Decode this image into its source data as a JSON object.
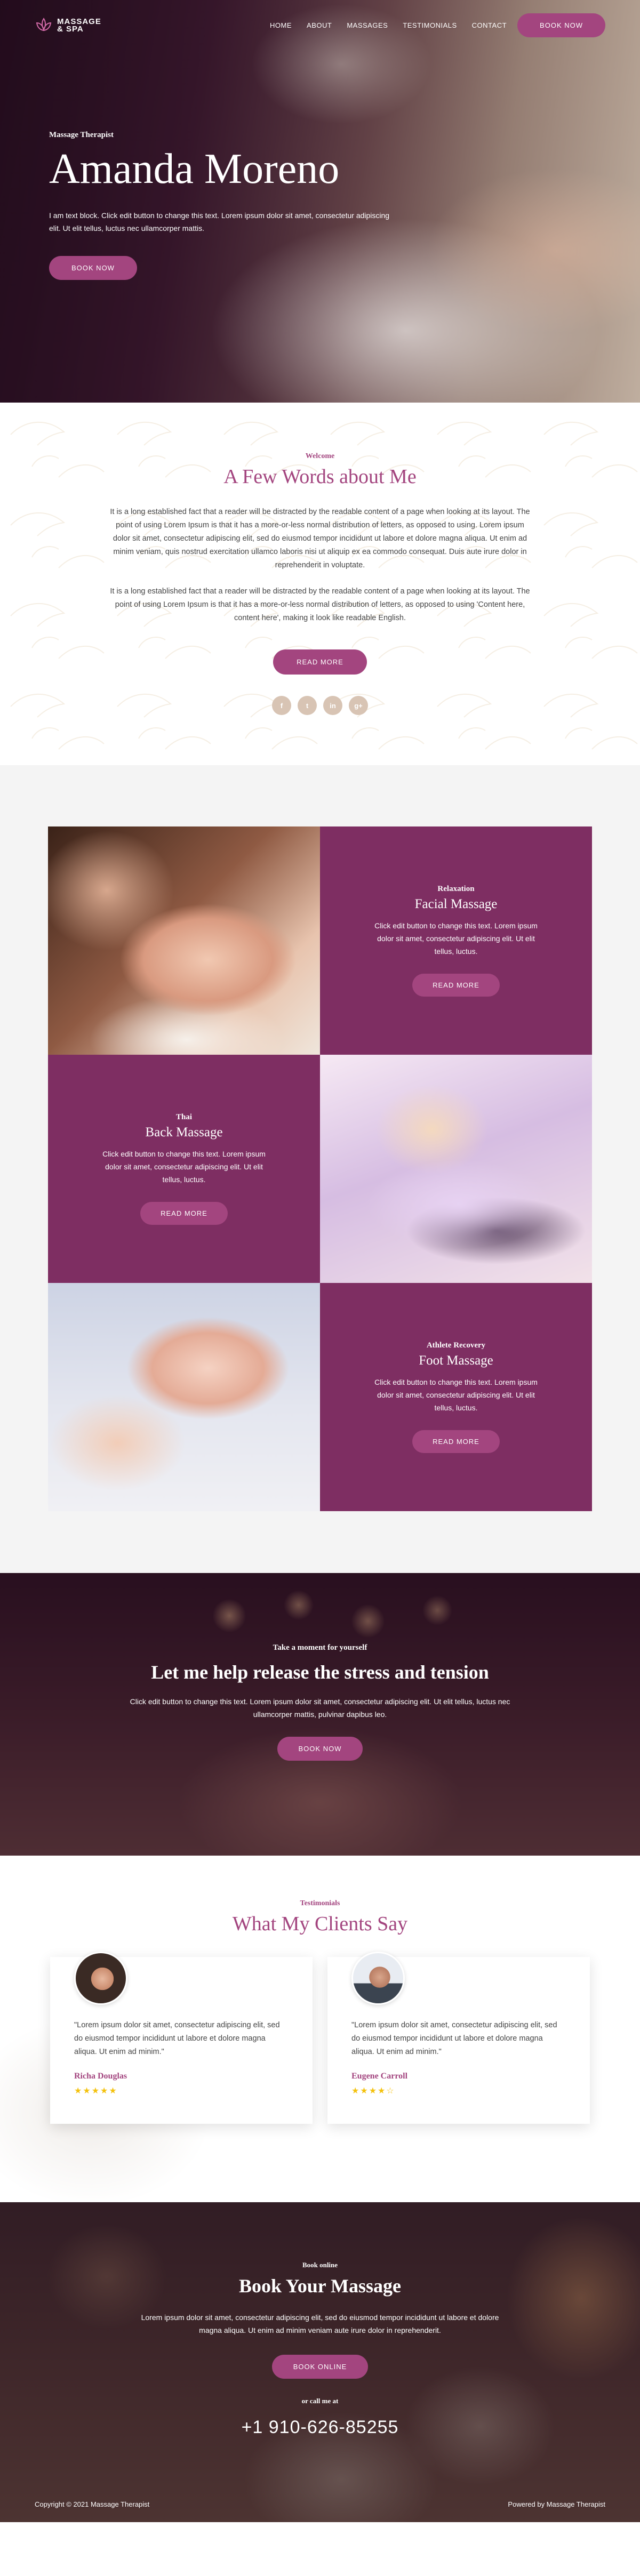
{
  "brand": {
    "line1": "MASSAGE",
    "line2": "& SPA"
  },
  "nav": {
    "items": [
      "HOME",
      "ABOUT",
      "MASSAGES",
      "TESTIMONIALS",
      "CONTACT"
    ],
    "cta": "BOOK NOW"
  },
  "hero": {
    "eyebrow": "Massage Therapist",
    "title": "Amanda Moreno",
    "text": "I am text block. Click edit button to change this text. Lorem ipsum dolor sit amet, consectetur adipiscing elit. Ut elit tellus, luctus nec ullamcorper mattis.",
    "cta": "BOOK NOW"
  },
  "about": {
    "eyebrow": "Welcome",
    "title": "A Few Words about Me",
    "p1": "It is a long established fact that a reader will be distracted by the readable content of a page when looking at its layout. The point of using Lorem Ipsum is that it has a more-or-less normal distribution of letters, as opposed to using. Lorem ipsum dolor sit amet, consectetur adipiscing elit, sed do eiusmod tempor incididunt ut labore et dolore magna aliqua. Ut enim ad minim veniam, quis nostrud exercitation ullamco laboris nisi ut aliquip ex ea commodo consequat. Duis aute irure dolor in reprehenderit in voluptate.",
    "p2": "It is a long established fact that a reader will be distracted by the readable content of a page when looking at its layout. The point of using Lorem Ipsum is that it has a more-or-less normal distribution of letters, as opposed to using 'Content here, content here', making it look like readable English.",
    "cta": "READ MORE",
    "social": [
      "f",
      "t",
      "in",
      "g+"
    ]
  },
  "services": [
    {
      "eyebrow": "Relaxation",
      "title": "Facial Massage",
      "text": "Click edit button to change this text. Lorem ipsum dolor sit amet, consectetur adipiscing elit. Ut elit tellus, luctus.",
      "cta": "READ MORE"
    },
    {
      "eyebrow": "Thai",
      "title": "Back Massage",
      "text": "Click edit button to change this text. Lorem ipsum dolor sit amet, consectetur adipiscing elit. Ut elit tellus, luctus.",
      "cta": "READ MORE"
    },
    {
      "eyebrow": "Athlete Recovery",
      "title": "Foot Massage",
      "text": "Click edit button to change this text. Lorem ipsum dolor sit amet, consectetur adipiscing elit. Ut elit tellus, luctus.",
      "cta": "READ MORE"
    }
  ],
  "stress": {
    "eyebrow": "Take a moment for yourself",
    "title": "Let me help release the stress and tension",
    "text": "Click edit button to change this text. Lorem ipsum dolor sit amet, consectetur adipiscing elit. Ut elit tellus, luctus nec ullamcorper mattis, pulvinar dapibus leo.",
    "cta": "BOOK NOW"
  },
  "testimonials": {
    "eyebrow": "Testimonials",
    "title": "What My Clients Say",
    "items": [
      {
        "quote": "\"Lorem ipsum dolor sit amet, consectetur adipiscing elit, sed do eiusmod tempor incididunt ut labore et dolore magna aliqua. Ut enim ad minim.\"",
        "name": "Richa Douglas",
        "rating": 5,
        "stars": "★★★★★"
      },
      {
        "quote": "\"Lorem ipsum dolor sit amet, consectetur adipiscing elit, sed do eiusmod tempor incididunt ut labore et dolore magna aliqua. Ut enim ad minim.\"",
        "name": "Eugene Carroll",
        "rating": 4.5,
        "stars": "★★★★☆"
      }
    ]
  },
  "book": {
    "eyebrow": "Book online",
    "title": "Book Your Massage",
    "text": "Lorem ipsum dolor sit amet, consectetur adipiscing elit, sed do eiusmod tempor incididunt ut labore et dolore magna aliqua. Ut enim ad minim veniam aute irure dolor in reprehenderit.",
    "cta": "BOOK ONLINE",
    "call": "or call me at",
    "phone": "+1 910-626-85255"
  },
  "footer": {
    "left": "Copyright © 2021 Massage Therapist",
    "right": "Powered by Massage Therapist"
  },
  "colors": {
    "accent": "#a3457f",
    "card": "#7e2e62",
    "star": "#f4c20d"
  }
}
